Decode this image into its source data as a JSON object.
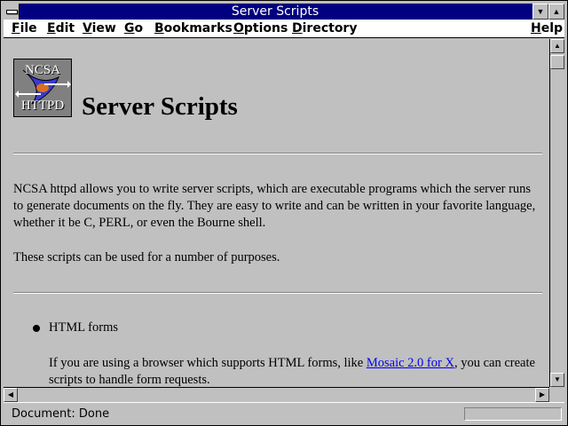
{
  "window": {
    "title": "Server Scripts"
  },
  "menubar": {
    "items": [
      "File",
      "Edit",
      "View",
      "Go",
      "Bookmarks",
      "Options",
      "Directory",
      "Help"
    ]
  },
  "page": {
    "logo": {
      "line1": "NCSA",
      "line2": "HTTPD"
    },
    "title": "Server Scripts",
    "paragraph1": "NCSA httpd allows you to write server scripts, which are executable programs which the server runs to generate documents on the fly. They are easy to write and can be written in your favorite language, whether it be C, PERL, or even the Bourne shell.",
    "paragraph2": "These scripts can be used for a number of purposes.",
    "list": [
      {
        "label": "HTML forms",
        "text_before": "If you are using a browser which supports HTML forms, like ",
        "link": "Mosaic 2.0 for X",
        "text_after": ", you can create scripts to handle form requests."
      }
    ]
  },
  "status": {
    "text": "Document: Done"
  },
  "colors": {
    "titlebar": "#000080",
    "face": "#c0c0c0",
    "link": "#0000ee"
  },
  "icons": [
    "system-menu-icon",
    "minimize-icon",
    "maximize-icon",
    "scroll-up-icon",
    "scroll-down-icon",
    "scroll-left-icon",
    "scroll-right-icon"
  ]
}
